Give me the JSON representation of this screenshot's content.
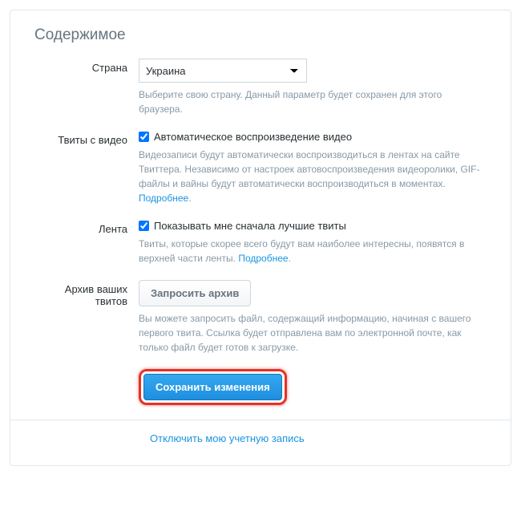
{
  "heading": "Содержимое",
  "country": {
    "label": "Страна",
    "selected": "Украина",
    "help": "Выберите свою страну. Данный параметр будет сохранен для этого браузера."
  },
  "video": {
    "label": "Твиты с видео",
    "checkbox_label": "Автоматическое воспроизведение видео",
    "help_pre": "Видеозаписи будут автоматически воспроизводиться в лентах на сайте Твиттера. Независимо от настроек автовоспроизведения видеоролики, GIF-файлы и вайны будут автоматически воспроизводиться в моментах. ",
    "more": "Подробнее"
  },
  "timeline": {
    "label": "Лента",
    "checkbox_label": "Показывать мне сначала лучшие твиты",
    "help_pre": "Твиты, которые скорее всего будут вам наиболее интересны, появятся в верхней части ленты. ",
    "more": "Подробнее"
  },
  "archive": {
    "label": "Архив ваших твитов",
    "button": "Запросить архив",
    "help": "Вы можете запросить файл, содержащий информацию, начиная с вашего первого твита. Ссылка будет отправлена вам по электронной почте, как только файл будет готов к загрузке."
  },
  "save_button": "Сохранить изменения",
  "deactivate": "Отключить мою учетную запись"
}
